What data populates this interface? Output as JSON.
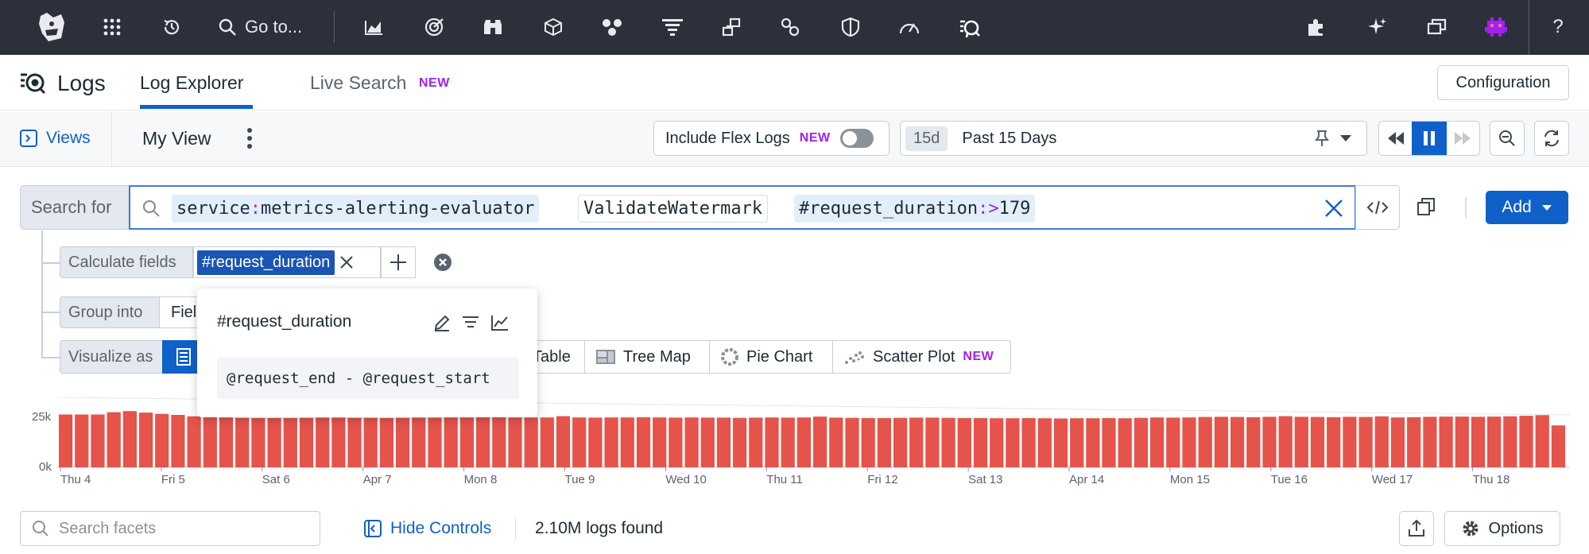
{
  "topnav": {
    "goto_label": "Go to...",
    "help_label": "?"
  },
  "header": {
    "app_title": "Logs",
    "tabs": [
      {
        "label": "Log Explorer",
        "active": true
      },
      {
        "label": "Live Search",
        "badge": "NEW",
        "active": false
      }
    ],
    "configuration_label": "Configuration"
  },
  "views_bar": {
    "views_label": "Views",
    "view_name": "My View",
    "flex_logs_label": "Include Flex Logs",
    "flex_logs_badge": "NEW",
    "flex_logs_enabled": false,
    "time_short": "15d",
    "time_label": "Past 15 Days"
  },
  "search": {
    "prefix_label": "Search for",
    "tokens": [
      {
        "key": "service",
        "sep": ":",
        "value": "metrics-alerting-evaluator"
      },
      {
        "text": "ValidateWatermark"
      },
      {
        "key": "#request_duration",
        "sep": ":>",
        "value": "179"
      }
    ],
    "add_label": "Add"
  },
  "controls": {
    "calculate_label": "Calculate fields",
    "calculated_field": "#request_duration",
    "group_label": "Group into",
    "group_value": "Fields",
    "visualize_label": "Visualize as",
    "viz_options": [
      {
        "label": "Table"
      },
      {
        "label": "Tree Map"
      },
      {
        "label": "Pie Chart"
      },
      {
        "label": "Scatter Plot",
        "badge": "NEW"
      }
    ]
  },
  "popup": {
    "field_name": "#request_duration",
    "formula": "@request_end - @request_start"
  },
  "chart_data": {
    "type": "bar",
    "title": "",
    "ylabel": "",
    "xlabel": "",
    "ylim": [
      0,
      25000
    ],
    "ytick_labels": [
      "25k",
      "0k"
    ],
    "xtick_labels": [
      "Thu 4",
      "Fri 5",
      "Sat 6",
      "Apr 7",
      "Mon 8",
      "Tue 9",
      "Wed 10",
      "Thu 11",
      "Fri 12",
      "Sat 13",
      "Apr 14",
      "Mon 15",
      "Tue 16",
      "Wed 17",
      "Thu 18"
    ],
    "bar_color": "#e5534b",
    "values": [
      25200,
      25200,
      25200,
      26300,
      26800,
      26100,
      25500,
      25000,
      24300,
      24100,
      23800,
      23600,
      23500,
      23500,
      23500,
      23600,
      23700,
      23700,
      23600,
      23600,
      23500,
      23600,
      23700,
      23700,
      23800,
      23800,
      23900,
      23900,
      23800,
      23800,
      23800,
      24400,
      23800,
      23700,
      23800,
      23800,
      23900,
      23800,
      23700,
      23800,
      23700,
      23700,
      23600,
      23700,
      23800,
      23700,
      23800,
      24200,
      23700,
      23600,
      23500,
      23500,
      23600,
      23700,
      23700,
      23600,
      23500,
      23500,
      23400,
      23400,
      23500,
      23400,
      23300,
      23400,
      23400,
      23500,
      23400,
      23600,
      23800,
      23700,
      23800,
      24000,
      24100,
      24000,
      23900,
      24100,
      24400,
      24100,
      24000,
      23900,
      24100,
      24000,
      24300,
      23800,
      23900,
      24100,
      24200,
      24200,
      24100,
      24200,
      24300,
      24600,
      24900,
      20000
    ]
  },
  "bottom": {
    "facet_placeholder": "Search facets",
    "hide_controls_label": "Hide Controls",
    "logs_found": "2.10M logs found",
    "options_label": "Options"
  },
  "colors": {
    "nav_bg": "#2c303a",
    "accent_blue": "#1060c9",
    "new_purple": "#a020f0",
    "bar_red": "#e5534b"
  }
}
